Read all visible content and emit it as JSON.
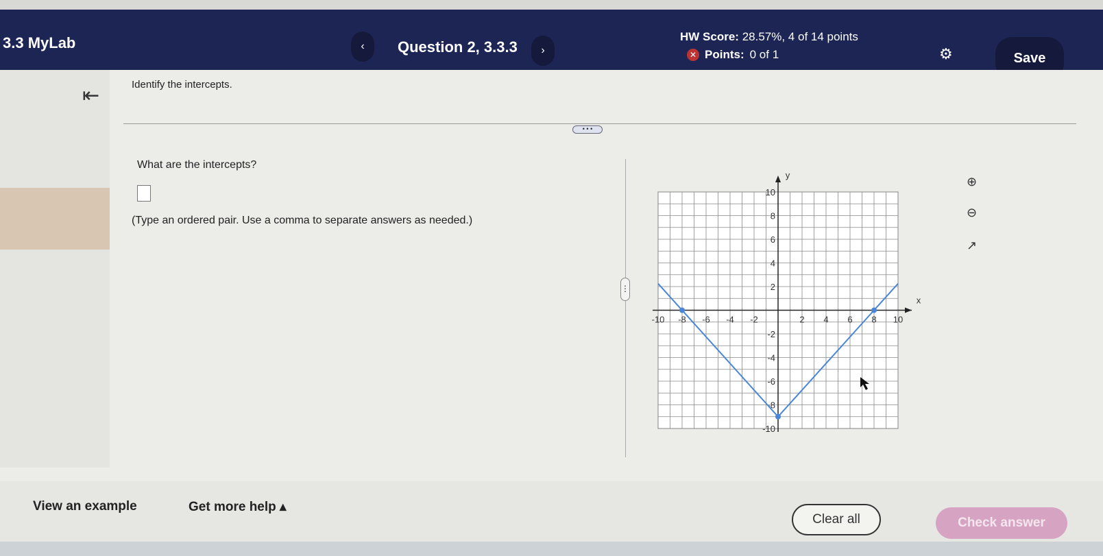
{
  "header": {
    "title": "3.3 MyLab",
    "question": "Question 2, 3.3.3",
    "prev": "‹",
    "next": "›",
    "score_label": "HW Score:",
    "score_value": "28.57%, 4 of 14 points",
    "points_label": "Points:",
    "points_value": "0 of 1",
    "save": "Save"
  },
  "content": {
    "instruction": "Identify the intercepts.",
    "more": "• • •",
    "question": "What are the intercepts?",
    "answer_value": "",
    "hint": "(Type an ordered pair. Use a comma to separate answers as needed.)"
  },
  "graph": {
    "x_label": "x",
    "y_label": "y",
    "x_ticks": [
      "-10",
      "-8",
      "-6",
      "-4",
      "-2",
      "2",
      "4",
      "6",
      "8",
      "10"
    ],
    "y_ticks": [
      "10",
      "8",
      "6",
      "4",
      "2",
      "-2",
      "-4",
      "-6",
      "-8",
      "-10"
    ],
    "xlim": [
      -10,
      10
    ],
    "ylim": [
      -10,
      10
    ],
    "function": "V-shape, vertex (0,-9)",
    "points": [
      [
        -8,
        0
      ],
      [
        0,
        -9
      ],
      [
        8,
        0
      ]
    ],
    "line_color": "#4a86d8"
  },
  "footer": {
    "view_example": "View an example",
    "more_help": "Get more help ▴",
    "clear_all": "Clear all",
    "check_answer": "Check answer"
  }
}
